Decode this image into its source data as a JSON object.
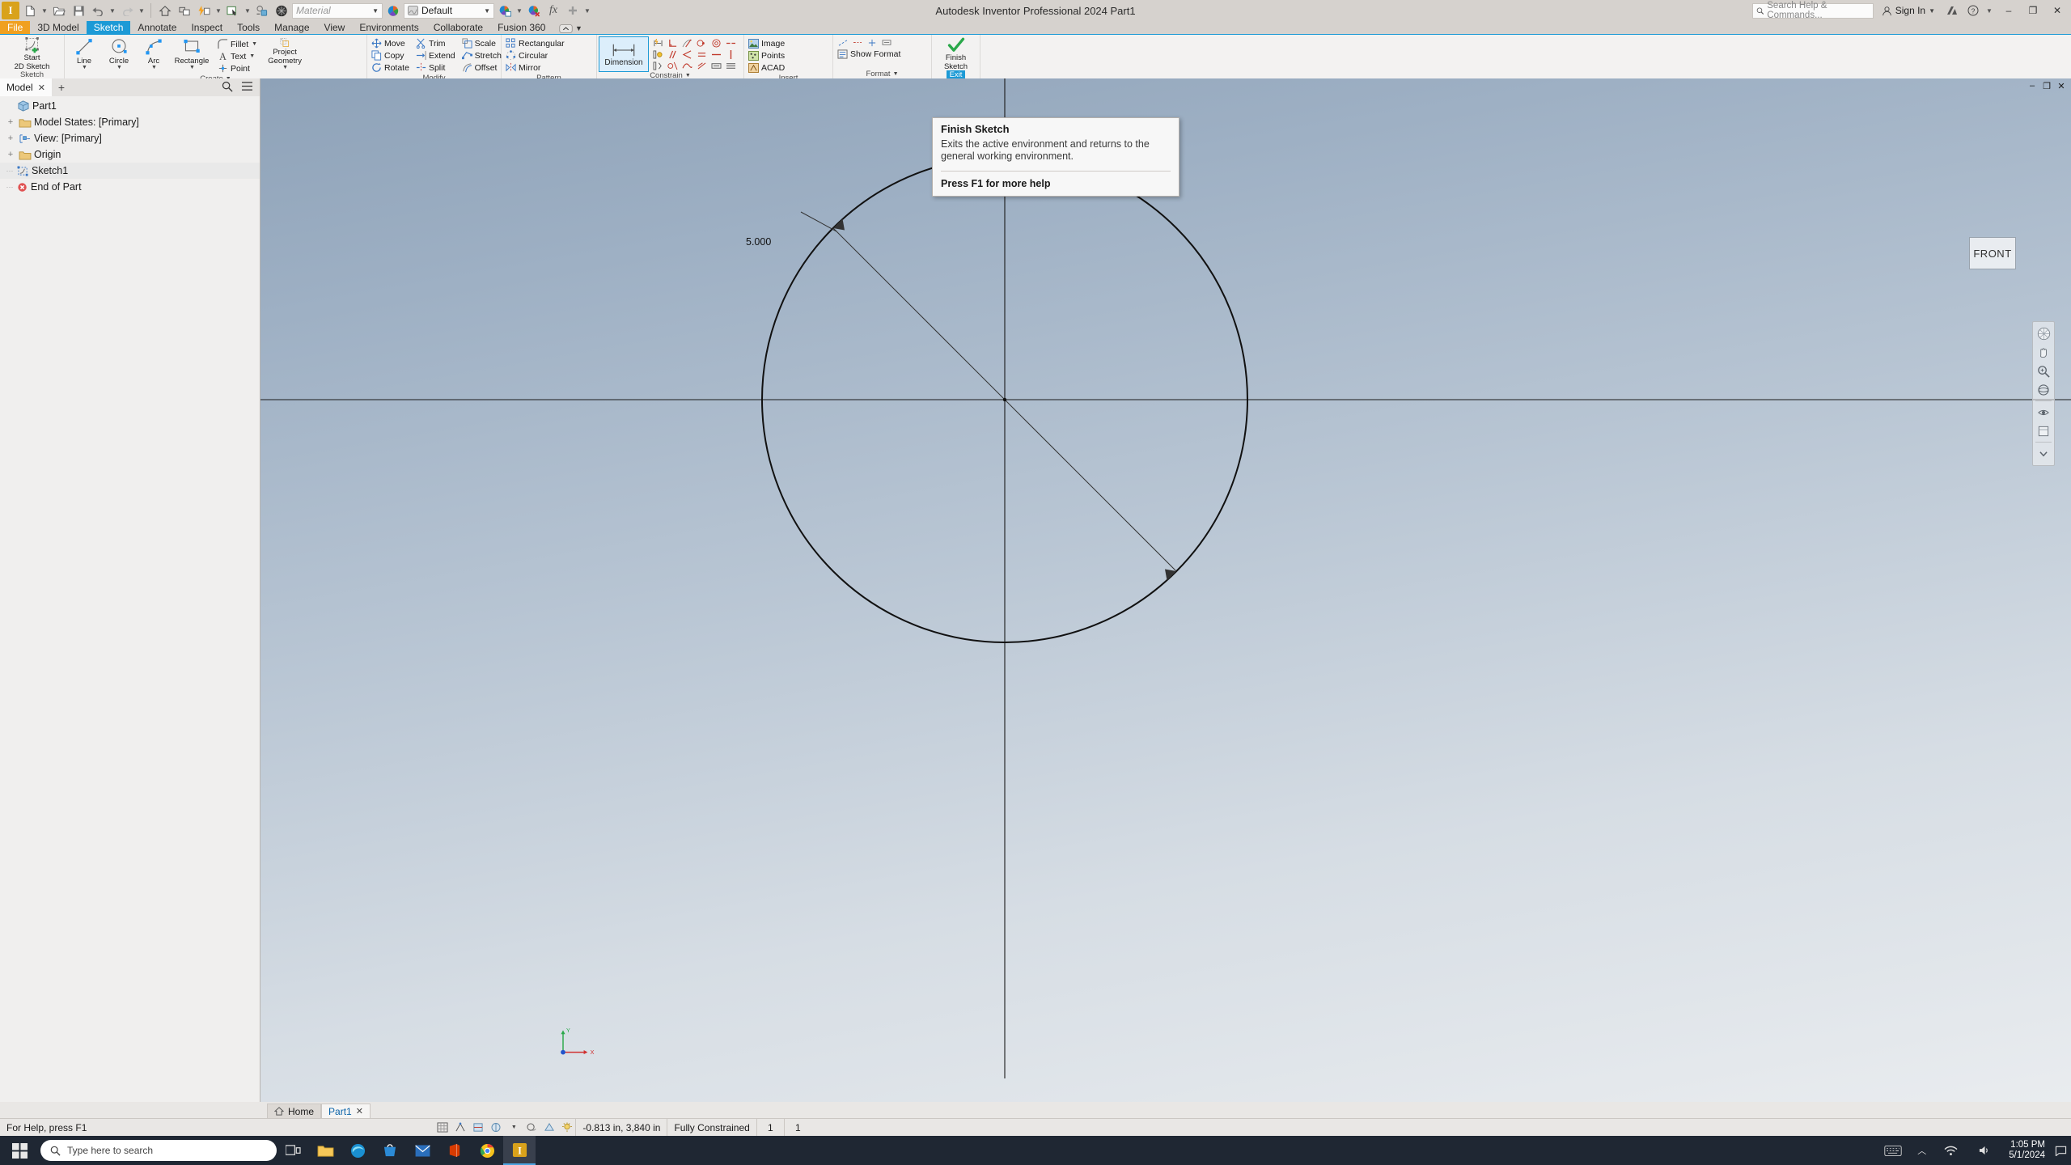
{
  "window": {
    "title": "Autodesk Inventor Professional 2024    Part1",
    "minimize": "–",
    "restore": "❐",
    "close": "✕"
  },
  "quick_access": {
    "logo_text": "I",
    "buttons": [
      {
        "name": "new-file",
        "tip": "New"
      },
      {
        "name": "open-file",
        "tip": "Open"
      },
      {
        "name": "save-file",
        "tip": "Save"
      },
      {
        "name": "undo",
        "tip": "Undo"
      },
      {
        "name": "redo",
        "tip": "Redo"
      },
      {
        "name": "home",
        "tip": "Home"
      },
      {
        "name": "return",
        "tip": "Return"
      },
      {
        "name": "update",
        "tip": "Update"
      },
      {
        "name": "select",
        "tip": "Select"
      },
      {
        "name": "appearance-drop",
        "tip": "Appearance"
      },
      {
        "name": "material-sphere",
        "tip": "Material"
      }
    ],
    "material_placeholder": "Material",
    "appearance_value": "Default",
    "fx_label": "fx"
  },
  "search": {
    "placeholder": "Search Help & Commands...",
    "sign_in": "Sign In"
  },
  "ribbon": {
    "tabs": [
      {
        "label": "File",
        "style": "file"
      },
      {
        "label": "3D Model",
        "style": ""
      },
      {
        "label": "Sketch",
        "style": "active"
      },
      {
        "label": "Annotate",
        "style": ""
      },
      {
        "label": "Inspect",
        "style": ""
      },
      {
        "label": "Tools",
        "style": ""
      },
      {
        "label": "Manage",
        "style": ""
      },
      {
        "label": "View",
        "style": ""
      },
      {
        "label": "Environments",
        "style": ""
      },
      {
        "label": "Collaborate",
        "style": ""
      },
      {
        "label": "Fusion 360",
        "style": ""
      }
    ],
    "panels": {
      "sketch": {
        "name": "Sketch",
        "start_2d_sketch": "Start\n2D Sketch",
        "start_2d_sketch_l1": "Start",
        "start_2d_sketch_l2": "2D Sketch"
      },
      "create": {
        "name": "Create",
        "line": "Line",
        "circle": "Circle",
        "arc": "Arc",
        "rectangle": "Rectangle",
        "fillet": "Fillet",
        "text": "Text",
        "point": "Point",
        "project_geometry_l1": "Project",
        "project_geometry_l2": "Geometry"
      },
      "modify": {
        "name": "Modify",
        "items": [
          "Move",
          "Copy",
          "Rotate",
          "Trim",
          "Extend",
          "Split",
          "Scale",
          "Stretch",
          "Offset"
        ]
      },
      "pattern": {
        "name": "Pattern",
        "items": [
          "Rectangular",
          "Circular",
          "Mirror"
        ]
      },
      "constrain": {
        "name": "Constrain",
        "dimension": "Dimension"
      },
      "insert": {
        "name": "Insert",
        "items": [
          "Image",
          "Points",
          "ACAD"
        ]
      },
      "format": {
        "name": "Format",
        "items": [
          "Show Format"
        ]
      },
      "exit": {
        "name": "Exit",
        "finish_l1": "Finish",
        "finish_l2": "Sketch"
      }
    }
  },
  "tooltip": {
    "title": "Finish Sketch",
    "body": "Exits the active environment and returns to the general working environment.",
    "footer": "Press F1 for more help"
  },
  "browser": {
    "tab_label": "Model",
    "close_glyph": "✕",
    "add_glyph": "+",
    "search_icon": "search-icon",
    "menu_icon": "hamburger-icon",
    "tree": [
      {
        "label": "Part1",
        "icon": "part-icon",
        "indent": 0,
        "expandable": false,
        "selected": false
      },
      {
        "label": "Model States: [Primary]",
        "icon": "folder-icon",
        "indent": 1,
        "expandable": true,
        "selected": false
      },
      {
        "label": "View: [Primary]",
        "icon": "view-icon",
        "indent": 1,
        "expandable": true,
        "selected": false
      },
      {
        "label": "Origin",
        "icon": "folder-icon",
        "indent": 1,
        "expandable": true,
        "selected": false
      },
      {
        "label": "Sketch1",
        "icon": "sketch-icon",
        "indent": 1,
        "expandable": false,
        "selected": true
      },
      {
        "label": "End of Part",
        "icon": "eop-icon",
        "indent": 1,
        "expandable": false,
        "selected": false
      }
    ]
  },
  "graphics": {
    "viewcube_label": "FRONT",
    "dimension_value": "5.000",
    "axis_x": "X",
    "axis_y": "Y",
    "window_minimize": "–",
    "window_restore": "❐",
    "window_close": "✕"
  },
  "doc_tabs": {
    "home": "Home",
    "part": "Part1",
    "close_glyph": "✕"
  },
  "statusbar": {
    "help_text": "For Help, press F1",
    "coordinates": "-0.813 in, 3,840 in",
    "constraint_state": "Fully Constrained",
    "dim_count": "1",
    "extra_count": "1"
  },
  "taskbar": {
    "search_placeholder": "Type here to search",
    "clock_time": "1:05 PM",
    "clock_date": "5/1/2024",
    "apps": [
      "task-view",
      "file-explorer",
      "edge",
      "store",
      "mail",
      "office",
      "chrome",
      "inventor"
    ]
  },
  "colors": {
    "accent_blue": "#1c9ad6",
    "file_orange": "#f0a020",
    "ribbon_bg": "#f3f2f1",
    "taskbar": "#1f2733",
    "sketch_line": "#0b0b0b"
  }
}
